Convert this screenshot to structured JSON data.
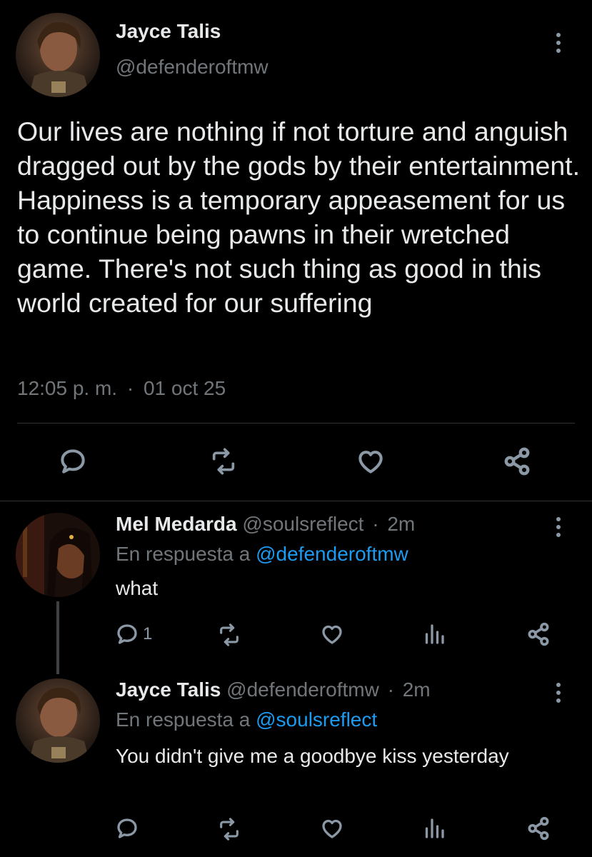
{
  "main_tweet": {
    "display_name": "Jayce Talis",
    "handle": "@defenderoftmw",
    "text": "Our lives are nothing if not torture and anguish dragged out by the gods by their entertainment. Happiness is a temporary appeasement for us to continue being pawns in their wretched game. There's not such thing as good in this world created for our suffering",
    "time": "12:05 p. m.",
    "separator": "·",
    "date": "01 oct 25"
  },
  "replies": [
    {
      "display_name": "Mel Medarda",
      "handle": "@soulsreflect",
      "separator": "·",
      "age": "2m",
      "reply_prefix": "En respuesta a",
      "reply_to": "@defenderoftmw",
      "text": "what",
      "reply_count": "1"
    },
    {
      "display_name": "Jayce Talis",
      "handle": "@defenderoftmw",
      "separator": "·",
      "age": "2m",
      "reply_prefix": "En respuesta a",
      "reply_to": "@soulsreflect",
      "text": "You didn't give me a goodbye kiss yesterday",
      "reply_count": ""
    }
  ],
  "icons": [
    "more-icon",
    "reply-icon",
    "retweet-icon",
    "like-icon",
    "share-icon",
    "analytics-icon"
  ],
  "colors": {
    "background": "#000000",
    "text": "#e7e9ea",
    "muted": "#71767b",
    "link": "#1d9bf0",
    "divider": "#2f3336"
  }
}
